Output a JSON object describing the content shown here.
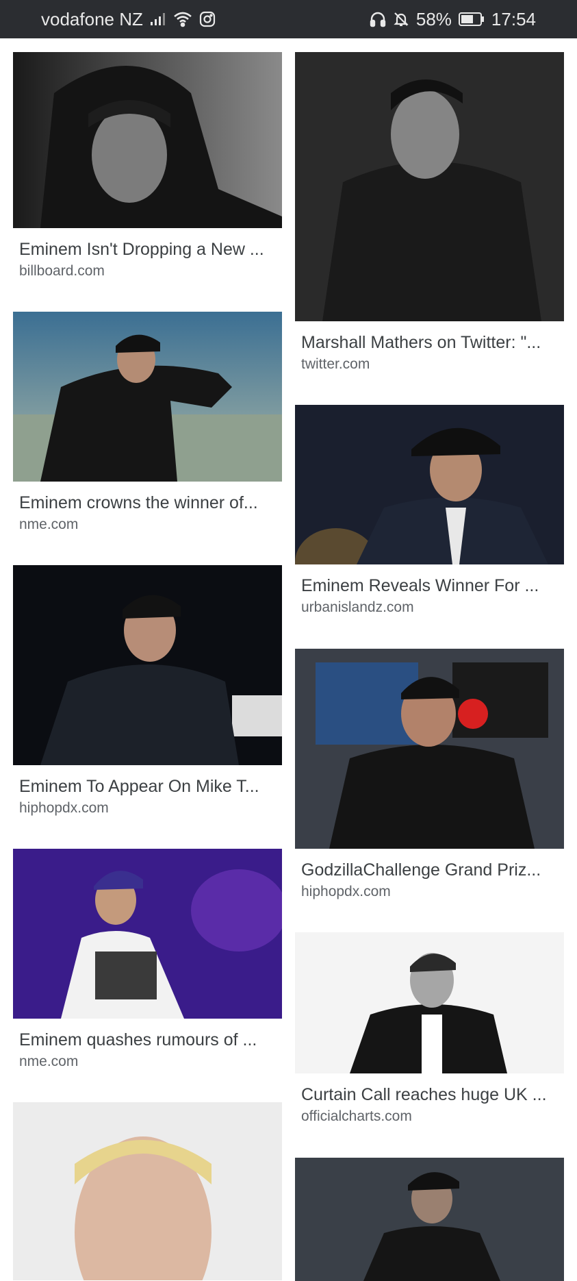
{
  "status_bar": {
    "carrier": "vodafone NZ",
    "battery": "58%",
    "time": "17:54",
    "icons": [
      "signal-icon",
      "wifi-icon",
      "instagram-icon",
      "headphones-icon",
      "bell-muted-icon",
      "battery-icon"
    ]
  },
  "results": {
    "left": [
      {
        "title": "Eminem Isn't Dropping a New ...",
        "source": "billboard.com",
        "image": "man-in-black-hoodie-bw"
      },
      {
        "title": "Eminem crowns the winner of...",
        "source": "nme.com",
        "image": "performer-with-microphone-stage"
      },
      {
        "title": "Eminem To Appear On Mike T...",
        "source": "hiphopdx.com",
        "image": "rapper-singing-into-microphone"
      },
      {
        "title": "Eminem quashes rumours of ...",
        "source": "nme.com",
        "image": "performer-purple-stage"
      },
      {
        "title": "",
        "source": "",
        "image": "blond-man-portrait"
      }
    ],
    "right": [
      {
        "title": "Marshall Mathers on Twitter: \"...",
        "source": "twitter.com",
        "image": "man-in-trench-coat-bw"
      },
      {
        "title": "Eminem Reveals Winner For ...",
        "source": "urbanislandz.com",
        "image": "man-in-fedora-and-suit"
      },
      {
        "title": "GodzillaChallenge Grand Priz...",
        "source": "hiphopdx.com",
        "image": "man-with-chain-street"
      },
      {
        "title": "Curtain Call reaches huge UK ...",
        "source": "officialcharts.com",
        "image": "man-leather-jacket-pointing"
      },
      {
        "title": "",
        "source": "",
        "image": "man-in-cap-stage"
      }
    ]
  }
}
